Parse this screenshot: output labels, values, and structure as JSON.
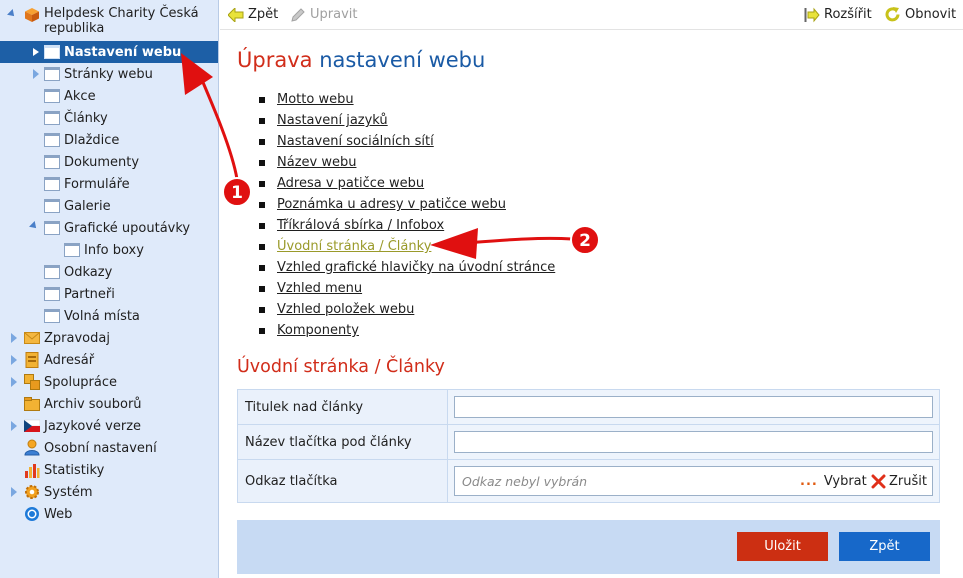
{
  "sidebar": {
    "root_label_line1": "Helpdesk Charity Česká",
    "root_label_line2": "republika",
    "items": [
      {
        "label": "Nastavení webu"
      },
      {
        "label": "Stránky webu"
      },
      {
        "label": "Akce"
      },
      {
        "label": "Články"
      },
      {
        "label": "Dlaždice"
      },
      {
        "label": "Dokumenty"
      },
      {
        "label": "Formuláře"
      },
      {
        "label": "Galerie"
      },
      {
        "label": "Grafické upoutávky"
      },
      {
        "label": "Info boxy"
      },
      {
        "label": "Odkazy"
      },
      {
        "label": "Partneři"
      },
      {
        "label": "Volná místa"
      }
    ],
    "modules": [
      {
        "label": "Zpravodaj",
        "icon": "envelope-icon"
      },
      {
        "label": "Adresář",
        "icon": "address-book-icon"
      },
      {
        "label": "Spolupráce",
        "icon": "collaboration-icon"
      },
      {
        "label": "Archiv souborů",
        "icon": "archive-icon"
      },
      {
        "label": "Jazykové verze",
        "icon": "czech-flag-icon"
      },
      {
        "label": "Osobní nastavení",
        "icon": "user-icon"
      },
      {
        "label": "Statistiky",
        "icon": "bar-chart-icon"
      },
      {
        "label": "Systém",
        "icon": "gear-icon"
      },
      {
        "label": "Web",
        "icon": "web-icon"
      }
    ]
  },
  "toolbar": {
    "back_label": "Zpět",
    "edit_label": "Upravit",
    "expand_label": "Rozšířit",
    "refresh_label": "Obnovit"
  },
  "main": {
    "title_part1": "Úprava",
    "title_part2": "nastavení webu",
    "links": [
      "Motto webu",
      "Nastavení jazyků",
      "Nastavení sociálních sítí",
      "Název webu",
      "Adresa v patičce webu",
      "Poznámka u adresy v patičce webu",
      "Tříkrálová sbírka / Infobox",
      "Úvodní stránka / Články",
      "Vzhled grafické hlavičky na úvodní stránce",
      "Vzhled menu",
      "Vzhled položek webu",
      "Komponenty"
    ],
    "active_link_index": 7,
    "section_title": "Úvodní stránka / Články",
    "form": {
      "field1_label": "Titulek nad články",
      "field1_value": "",
      "field2_label": "Název tlačítka pod články",
      "field2_value": "",
      "field3_label": "Odkaz tlačítka",
      "field3_placeholder": "Odkaz nebyl vybrán",
      "select_label": "Vybrat",
      "clear_label": "Zrušit"
    },
    "save_label": "Uložit",
    "back_label": "Zpět"
  },
  "annotations": {
    "badge1": "1",
    "badge2": "2"
  },
  "colors": {
    "accent_red": "#d12d1a",
    "accent_blue": "#1a5aa5",
    "selected_bg": "#1d5fa6",
    "save_button": "#cc2f12",
    "back_button": "#1768c9"
  }
}
